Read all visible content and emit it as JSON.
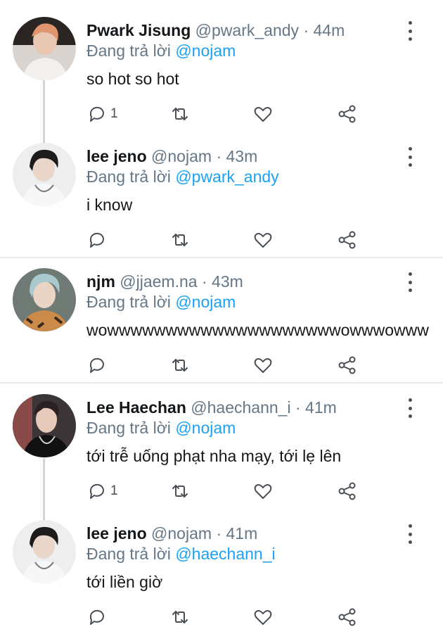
{
  "replying_prefix": "Đang trả lời",
  "tweets": [
    {
      "name": "Pwark Jisung",
      "handle": "@pwark_andy",
      "separator": "·",
      "time": "44m",
      "reply_to": "@nojam",
      "text": "so hot so hot",
      "reply_count": "1"
    },
    {
      "name": "lee jeno",
      "handle": "@nojam",
      "separator": "·",
      "time": "43m",
      "reply_to": "@pwark_andy",
      "text": "i know",
      "reply_count": ""
    },
    {
      "name": "njm",
      "handle": "@jjaem.na",
      "separator": "·",
      "time": "43m",
      "reply_to": "@nojam",
      "text": "wowwwwwwwwwwwwwwwwwwwwowwwowww",
      "reply_count": ""
    },
    {
      "name": "Lee Haechan",
      "handle": "@haechann_i",
      "separator": "·",
      "time": "41m",
      "reply_to": "@nojam",
      "text": "tới trễ uống phạt nha mạy, tới lẹ lên",
      "reply_count": "1"
    },
    {
      "name": "lee jeno",
      "handle": "@nojam",
      "separator": "·",
      "time": "41m",
      "reply_to": "@haechann_i",
      "text": "tới liền giờ",
      "reply_count": ""
    }
  ],
  "colors": {
    "mention": "#1da1f2",
    "secondary_text": "#657786",
    "icon": "#4a4f55",
    "thread_line": "#ccd6dd",
    "divider": "#e6ecf0"
  },
  "icons": [
    "reply-icon",
    "retweet-icon",
    "like-icon",
    "share-icon",
    "more-options-icon"
  ]
}
